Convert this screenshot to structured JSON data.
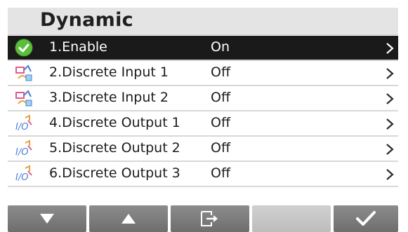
{
  "screen": {
    "title": "Dynamic"
  },
  "menu": {
    "items": [
      {
        "label": "1.Enable",
        "value": "On",
        "icon": "check-circle-icon",
        "selected": true
      },
      {
        "label": "2.Discrete Input 1",
        "value": "Off",
        "icon": "discrete-input-icon",
        "selected": false
      },
      {
        "label": "3.Discrete Input 2",
        "value": "Off",
        "icon": "discrete-input-icon",
        "selected": false
      },
      {
        "label": "4.Discrete Output 1",
        "value": "Off",
        "icon": "discrete-output-icon",
        "selected": false
      },
      {
        "label": "5.Discrete Output 2",
        "value": "Off",
        "icon": "discrete-output-icon",
        "selected": false
      },
      {
        "label": "6.Discrete Output 3",
        "value": "Off",
        "icon": "discrete-output-icon",
        "selected": false
      }
    ]
  },
  "softkeys": [
    {
      "name": "down-arrow-icon"
    },
    {
      "name": "up-arrow-icon"
    },
    {
      "name": "exit-icon"
    },
    {
      "name": "blank"
    },
    {
      "name": "checkmark-icon"
    }
  ],
  "colors": {
    "selected_row_bg": "#1a1a1a",
    "title_bar_bg": "#e4e4e4",
    "softkey_bg": "#7d7d7d",
    "check_green": "#5bbf3c"
  }
}
